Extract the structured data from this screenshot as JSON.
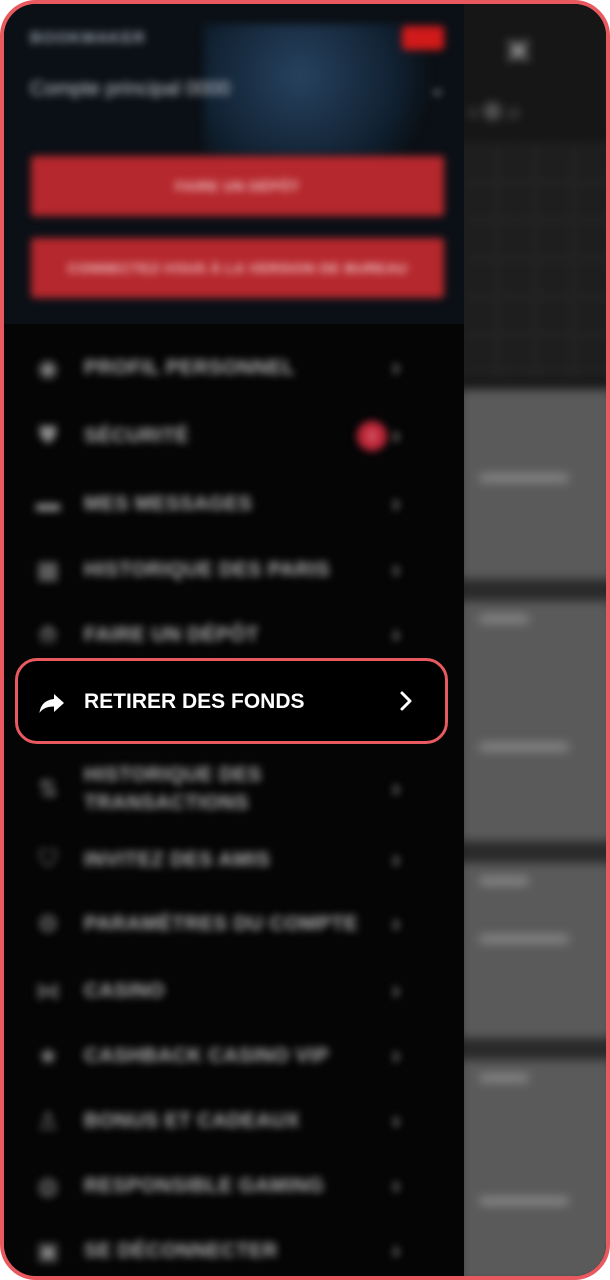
{
  "drawer": {
    "brand": "BOOKMAKER",
    "account_label": "Compte principal 0000",
    "deposit_button": "FAIRE UN DÉPÔT",
    "desktop_button": "CONNECTEZ-VOUS À LA VERSION DE BUREAU",
    "menu": [
      {
        "label": "PROFIL PERSONNEL",
        "icon": "user-icon"
      },
      {
        "label": "SÉCURITÉ",
        "icon": "shield-icon",
        "badge": "!"
      },
      {
        "label": "MES MESSAGES",
        "icon": "envelope-icon"
      },
      {
        "label": "HISTORIQUE DES PARIS",
        "icon": "history-icon"
      },
      {
        "label": "FAIRE UN DÉPÔT",
        "icon": "deposit-icon"
      },
      {
        "label": "RETIRER DES FONDS",
        "icon": "share-arrow-icon"
      },
      {
        "label": "HISTORIQUE DES TRANSACTIONS",
        "icon": "transactions-icon"
      },
      {
        "label": "INVITEZ DES AMIS",
        "icon": "gift-icon"
      },
      {
        "label": "PARAMÈTRES DU COMPTE",
        "icon": "gear-icon"
      },
      {
        "label": "CASINO",
        "icon": "casino-icon"
      },
      {
        "label": "CASHBACK CASINO VIP",
        "icon": "star-icon"
      },
      {
        "label": "BONUS ET CADEAUX",
        "icon": "bonus-icon"
      },
      {
        "label": "RESPONSIBLE GAMING",
        "icon": "responsible-icon"
      },
      {
        "label": "SE DÉCONNECTER",
        "icon": "logout-icon"
      }
    ]
  },
  "background": {
    "close_glyph": "✕"
  },
  "colors": {
    "frame_border": "#e85a5f",
    "red_button": "#b5282d",
    "badge": "#c0283a"
  }
}
